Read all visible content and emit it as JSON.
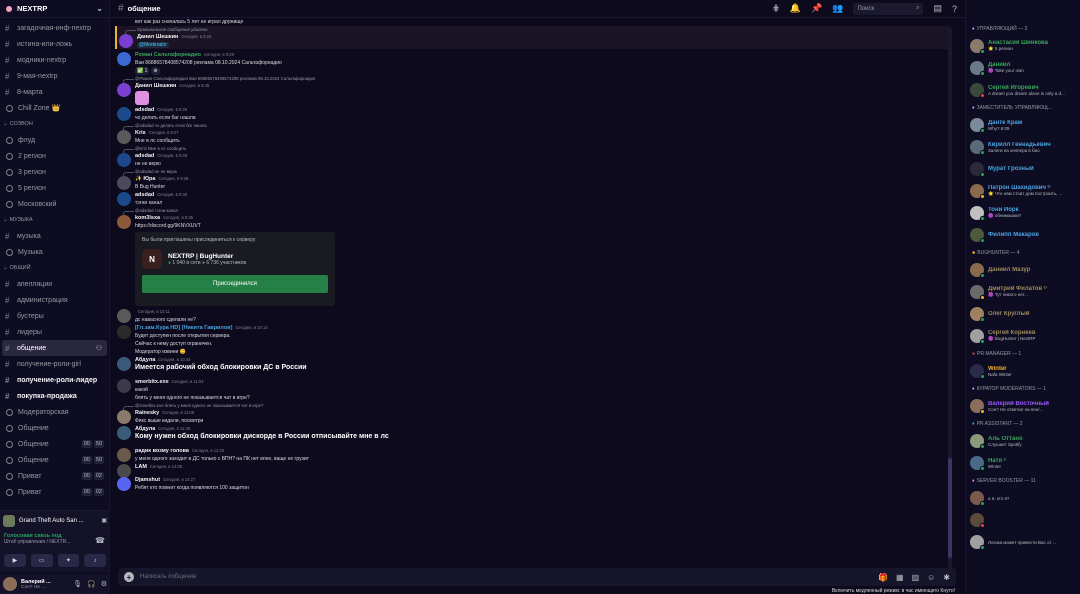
{
  "server": {
    "name": "NEXTRP"
  },
  "channels": {
    "top": [
      {
        "name": "загадочная-инф-nextrp",
        "bold": false
      },
      {
        "name": "истина-или-ложь",
        "bold": false
      },
      {
        "name": "модники-nextrp",
        "bold": false
      },
      {
        "name": "9-мая-nextrp",
        "bold": false
      },
      {
        "name": "8-марта",
        "bold": false
      },
      {
        "name": "Chill Zone 👑",
        "bold": false
      }
    ],
    "cat_svozon": "СОЗВОН",
    "svozon": [
      "флуд",
      "2 регион",
      "3 регион",
      "5 регион",
      "Московский"
    ],
    "cat_music": "МУЗЫКА",
    "music": [
      "музыка",
      "Музыка"
    ],
    "cat_general": "ОБЩИЙ",
    "general": [
      {
        "name": "апелляции",
        "bold": false
      },
      {
        "name": "администрация",
        "bold": false
      },
      {
        "name": "бустеры",
        "bold": false
      },
      {
        "name": "лидеры",
        "bold": false
      },
      {
        "name": "общение",
        "bold": false,
        "active": true
      },
      {
        "name": "получение-роли-girl",
        "bold": false
      },
      {
        "name": "получение-роли-лидер",
        "bold": true
      },
      {
        "name": "покупка-продажа",
        "bold": true
      },
      {
        "name": "Модераторская",
        "bold": false
      }
    ],
    "voice_bottom": [
      {
        "name": "Общение",
        "badges": []
      },
      {
        "name": "Общение",
        "badges": [
          "00",
          "50"
        ]
      },
      {
        "name": "Общение",
        "badges": [
          "00",
          "50"
        ]
      },
      {
        "name": "Приват",
        "badges": [
          "00",
          "02"
        ]
      },
      {
        "name": "Приват",
        "badges": [
          "00",
          "02"
        ]
      }
    ]
  },
  "game": {
    "name": "Grand Theft Auto San ..."
  },
  "voice_conn": {
    "title": "Голосовая связь под",
    "sub": "Штаб управления / NEXTR..."
  },
  "user": {
    "name": "Валерий ...",
    "status": "Сон? Не ..."
  },
  "topbar": {
    "channel": "общение",
    "search_placeholder": "Поиск"
  },
  "messages": {
    "m0": "вот как раз сначалась 5 лет не играл дружище",
    "r1": "Оригинальное сообщение удалено",
    "m1_author": "Данил Шешкин",
    "m1_time": "Сегодня, в 9:24",
    "m1_tag": "@Moderator",
    "m2_author": "Роман Сальтафорнадио",
    "m2_time": "Сегодня, в 9:29",
    "m2_text": "Ваи 86886578408574208 реклама 08.10.2024 Сальтафорнадио",
    "r3": "@Роман Сальтафорнадио Ваи 86886578408574208 реклама 08.10.2024 Сальтафорнадио",
    "m3_author": "Данил Шешкин",
    "m3_time": "Сегодня, в 9:45",
    "m4_author": "adsdad",
    "m4_time": "Сегодня, в 9:26",
    "m4_text": "чо делать если баг нашла",
    "r5": "@adsdad чо делать если баг нашла",
    "m5_author": "Kris",
    "m5_time": "Сегодня, в 9:27",
    "m5_text": "Мне в лс сообщить",
    "r6": "@Kris Мне в лс сообщить",
    "m6_author": "adsdad",
    "m6_time": "Сегодня, в 9:28",
    "m6_text": "не не верю",
    "r7": "@adsdad не не верю",
    "m7_author": "✨ Юра",
    "m7_time": "Сегодня, в 9:29",
    "m7_text": "В Bug Hunter",
    "m8_author": "adsdad",
    "m8_time": "Сегодня, в 9:32",
    "m8_text": "тэгни канал",
    "r9": "@adsdad тэгни канал",
    "m9_author": "kom3lsxa",
    "m9_time": "Сегодня, в 9:35",
    "m9_link": "https://discord.gg/9KNVXUVT",
    "invite_title": "Вы были приглашены присоединиться к серверу",
    "invite_server": "NEXTRP | BugHunter",
    "invite_online": "1 040 в сети",
    "invite_members": "6 736 участников",
    "invite_btn": "Присоединился",
    "m10_author": "",
    "m10_time": "Сегодня, в 10:11",
    "m10_text": "дс навасного сделали не?",
    "m11_author": "[Гл.зам.Кура HD] [Никита Гаврилов]",
    "m11_time": "Сегодня, в 10:14",
    "m11_line1": "Будет доступен после открытия сервера.",
    "m11_line2": "Сейчас к нему доступ ограничен.",
    "m11_line3": "Модератор извини 😊",
    "m12_author": "Абдула",
    "m12_time": "Сегодня, в 10:44",
    "m12_big": "Имеется рабочий обход блокировки ДС в России",
    "m13_author": "smerbitx.exe",
    "m13_time": "Сегодня, в 11:04",
    "m13_line1": "какой",
    "m13_line2": "блять у меня одного не показывается чат в игре?",
    "r14": "@smerbitx.exe блять у меня одного не показывается чат в игре?",
    "m14_author": "Rainesky",
    "m14_time": "Сегодня, в 11:08",
    "m14_text": "Фикс выше кидали, посмотри",
    "m15_author": "Абдула",
    "m15_time": "Сегодня, в 11:49",
    "m15_big": "Кому нужен обход блокировки дискорде в России отписывайте мне в лс",
    "m16_author": "радик возму голова",
    "m16_time": "Сегодня, в 12:20",
    "m16_text": "у меня одного заходит в ДС только с ВПН? на ПК нет впне, ваще не грузит",
    "m17_author": "LAM",
    "m17_time": "Сегодня, в 14:05",
    "m18_author": "Djamshut",
    "m18_time": "Сегодня, в 14:27",
    "m18_text": "Ребят кто помнит когда появляются 100 защитон"
  },
  "input": {
    "placeholder": "Написать #общение"
  },
  "footer_note": "Включить медленный режим: в час имеющего Кнуто!",
  "members": {
    "g1": "УПРАВЛЯЮЩИЙ — 3",
    "g1_list": [
      {
        "name": "Анастасия Шинкова",
        "sub": "⭐ 5 регион",
        "color": "#3ba55c",
        "av": "#8a7a6a",
        "st": "#23a55a"
      },
      {
        "name": "Даниил",
        "sub": "🟣 Take your own",
        "color": "#3ba55c",
        "av": "#6a7a8a",
        "st": "#23a55a"
      },
      {
        "name": "Сергей Игоревич",
        "sub": "A dream you dream alone is only a d...",
        "color": "#3ba55c",
        "av": "#3a4a3a",
        "st": "#f23f43"
      }
    ],
    "g2": "ЗАМЕСТИТЕЛЬ УПРАВЛЯЮЩ...",
    "g2_list": [
      {
        "name": "Данте Крам",
        "sub": "Why? 6:05",
        "color": "#4aa3df",
        "av": "#7a8a9a",
        "st": "#23a55a"
      },
      {
        "name": "Кирилл Геннадьевич",
        "sub": "Залеги на хелпера в био",
        "color": "#4aa3df",
        "av": "#5a6a7a",
        "st": "#23a55a"
      },
      {
        "name": "Мурат Грозный",
        "sub": "",
        "color": "#4aa3df",
        "av": "#2a2a3a",
        "st": "#23a55a"
      },
      {
        "name": "Патрон Шахидович ᵁ",
        "sub": "⭐ Что нам стоит дом построить, ...",
        "color": "#4aa3df",
        "av": "#8a6a4a",
        "st": "#f0b232"
      },
      {
        "name": "Тони Йорк",
        "sub": "🟣 обнимашки?",
        "color": "#4aa3df",
        "av": "#c0c0c0",
        "st": "#23a55a"
      },
      {
        "name": "Филипп Макаров",
        "sub": "",
        "color": "#4aa3df",
        "av": "#4a5a3a",
        "st": "#23a55a"
      }
    ],
    "g3": "BUGHUNTER — 4",
    "g3_list": [
      {
        "name": "Даниил Мазур",
        "sub": "",
        "color": "#9c8a5a",
        "av": "#8a6a4a",
        "st": "#23a55a"
      },
      {
        "name": "Дмитрий Филатов ᵁ",
        "sub": "🟣 Тут никого нет...",
        "color": "#9c8a5a",
        "av": "#6a6a6a",
        "st": "#f0b232"
      },
      {
        "name": "Олег Круглый",
        "sub": "",
        "color": "#9c8a5a",
        "av": "#a08060",
        "st": "#23a55a"
      },
      {
        "name": "Сергей Корнеев",
        "sub": "🟣 BugHunter | NextRP",
        "color": "#9c8a5a",
        "av": "#a0a0a0",
        "st": "#23a55a"
      }
    ],
    "g4": "PR MANAGER — 1",
    "g4_list": [
      {
        "name": "Winter",
        "sub": "Nafa Winter",
        "color": "#f0b232",
        "av": "#2a2a4a",
        "st": "#23a55a"
      }
    ],
    "g5": "КУРАТОР MODERATORS — 1",
    "g5_list": [
      {
        "name": "Валерий Восточный",
        "sub": "Сон? Не ответил на пен/...",
        "color": "#9b59ff",
        "av": "#8a6e5a",
        "st": "#f0b232"
      }
    ],
    "g6": "PR ASSISTANT — 2",
    "g6_list": [
      {
        "name": "Аль Оттано",
        "sub": "Слушает Spotify",
        "color": "#3ba55c",
        "av": "#8a9a7a",
        "st": "#23a55a"
      },
      {
        "name": "Натя ᵁ",
        "sub": "Winter",
        "color": "#3ba55c",
        "av": "#4a6a8a",
        "st": "#23a55a"
      }
    ],
    "g7": "SERVER BOOSTER — 11",
    "g7_list": [
      {
        "name": "",
        "sub": "а я, кто я?",
        "color": "#f47fff",
        "av": "#7a5a4a",
        "st": "#23a55a"
      },
      {
        "name": "",
        "sub": "",
        "color": "#f47fff",
        "av": "#5a4a3a",
        "st": "#f23f43"
      },
      {
        "name": "",
        "sub": "Логика может привести Вас от ...",
        "color": "#f47fff",
        "av": "#a0a0a0",
        "st": "#23a55a"
      }
    ]
  }
}
